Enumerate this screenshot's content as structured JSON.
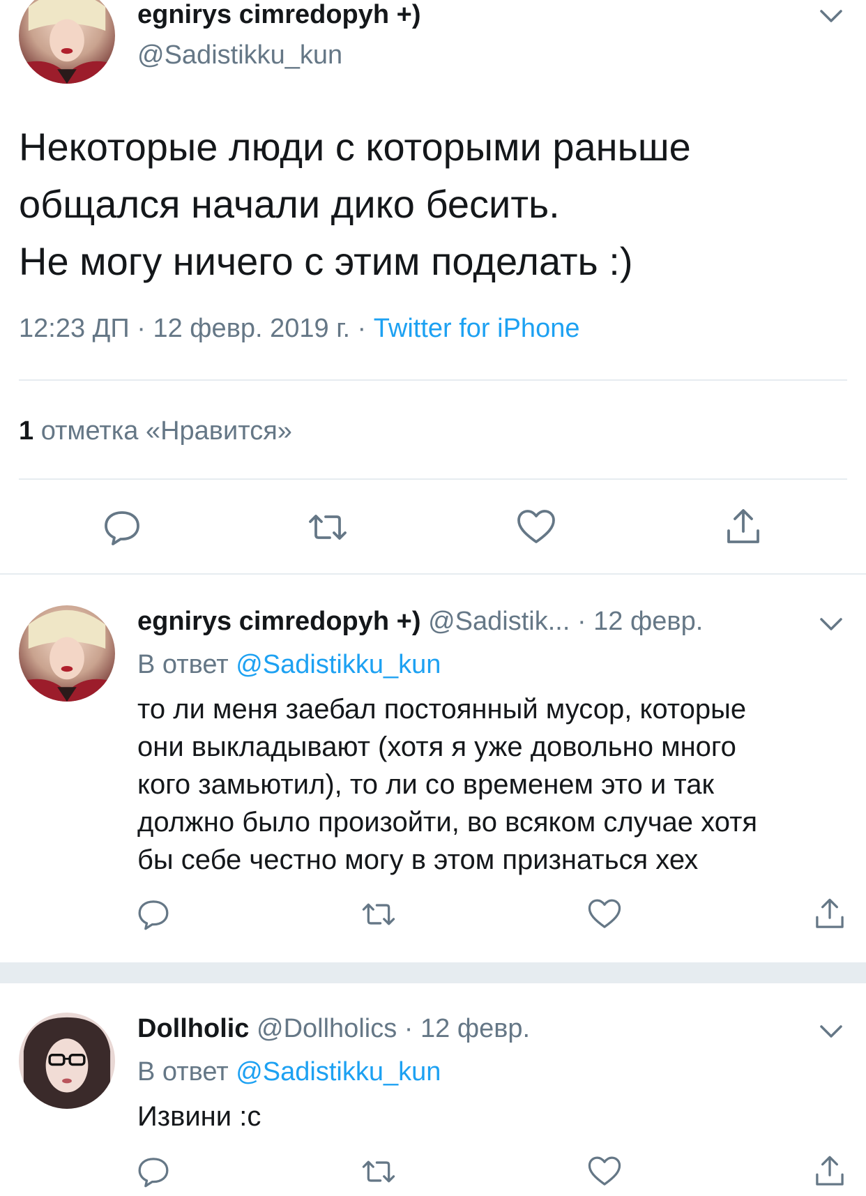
{
  "main_tweet": {
    "author_name": "egnirys cimredopyh +)",
    "author_handle": "@Sadistikku_kun",
    "text": "Некоторые люди с которыми раньше\nобщался начали дико бесить.\nНе могу ничего с этим поделать :)",
    "time": "12:23 ДП · 12 февр. 2019 г. · ",
    "source": "Twitter for iPhone",
    "likes_count": "1",
    "likes_label": " отметка «Нравится»"
  },
  "replies": [
    {
      "author_name": "egnirys cimredopyh +)",
      "author_handle": "@Sadistik...",
      "date": " · 12 февр.",
      "reply_to_label": "В ответ ",
      "reply_to_handle": "@Sadistikku_kun",
      "text": "то ли меня заебал постоянный мусор, которые\nони выкладывают (хотя я уже довольно много\nкого замьютил), то ли со временем это и так\nдолжно было произойти, во всяком случае хотя\nбы себе честно могу в этом признаться хех"
    },
    {
      "author_name": "Dollholic",
      "author_handle": "@Dollholics",
      "date": " · 12 февр.",
      "reply_to_label": "В ответ ",
      "reply_to_handle": "@Sadistikku_kun",
      "text": "Извини :с"
    }
  ],
  "icons": {
    "reply": "reply-icon",
    "retweet": "retweet-icon",
    "like": "heart-icon",
    "share": "share-icon",
    "more": "chevron-down-icon"
  },
  "colors": {
    "text": "#14171a",
    "secondary": "#657786",
    "accent": "#1da1f2",
    "divider": "#e6ecf0"
  }
}
